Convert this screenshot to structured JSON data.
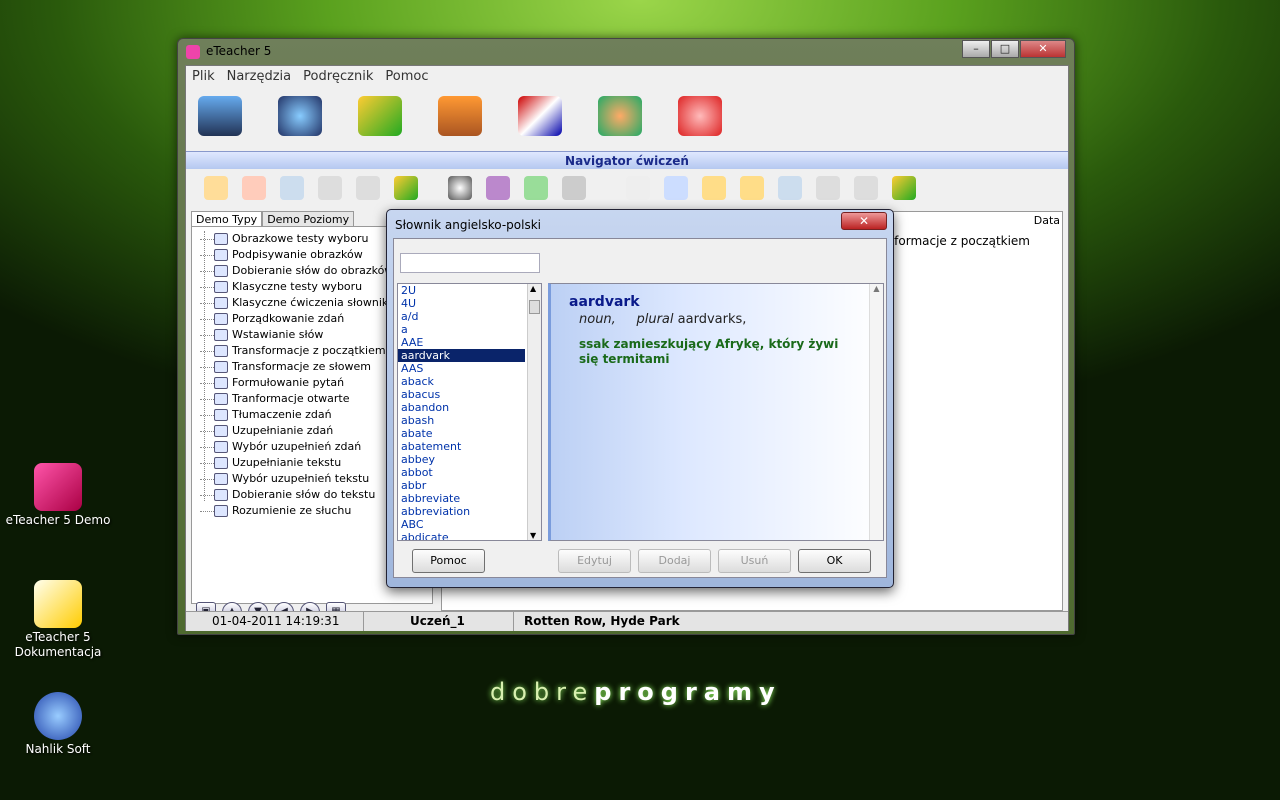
{
  "desktop": {
    "icons": [
      {
        "label": "eTeacher 5 Demo"
      },
      {
        "label_line1": "eTeacher 5",
        "label_line2": "Dokumentacja"
      },
      {
        "label": "Nahlik Soft"
      }
    ],
    "brand": {
      "part1": "dobre",
      "part2": "programy"
    }
  },
  "window": {
    "title": "eTeacher 5",
    "menu": [
      "Plik",
      "Narzędzia",
      "Podręcznik",
      "Pomoc"
    ],
    "navigator_header": "Navigator ćwiczeń",
    "tabs": [
      "Demo Typy",
      "Demo Poziomy"
    ],
    "tree_items": [
      "Obrazkowe testy wyboru",
      "Podpisywanie obrazków",
      "Dobieranie słów do obrazków",
      "Klasyczne testy wyboru",
      "Klasyczne ćwiczenia słownikowe",
      "Porządkowanie zdań",
      "Wstawianie słów",
      "Transformacje z początkiem",
      "Transformacje ze słowem",
      "Formułowanie pytań",
      "Tranformacje otwarte",
      "Tłumaczenie zdań",
      "Uzupełnianie zdań",
      "Wybór uzupełnień zdań",
      "Uzupełnianie tekstu",
      "Wybór uzupełnień tekstu",
      "Dobieranie słów do tekstu",
      "Rozumienie ze słuchu"
    ],
    "right_header": "Data",
    "right_row": "nsformacje z początkiem",
    "status": {
      "datetime": "01-04-2011 14:19:31",
      "user": "Uczeń_1",
      "location": "Rotten Row, Hyde Park"
    }
  },
  "dialog": {
    "title": "Słownik angielsko-polski",
    "search_value": "",
    "words": [
      "2U",
      "4U",
      "a/d",
      "a",
      "AAE",
      "aardvark",
      "AAS",
      "aback",
      "abacus",
      "abandon",
      "abash",
      "abate",
      "abatement",
      "abbey",
      "abbot",
      "abbr",
      "abbreviate",
      "abbreviation",
      "ABC",
      "abdicate"
    ],
    "selected_word": "aardvark",
    "definition": {
      "headword": "aardvark",
      "pos": "noun,",
      "plural_label": "plural",
      "plural_form": "aardvarks,",
      "translation_line1": "ssak zamieszkujący Afrykę, który żywi",
      "translation_line2": "się termitami"
    },
    "buttons": {
      "help": "Pomoc",
      "edit": "Edytuj",
      "add": "Dodaj",
      "delete": "Usuń",
      "ok": "OK"
    }
  },
  "colors": {
    "accent": "#0a246a",
    "translation": "#1a6a1a"
  }
}
